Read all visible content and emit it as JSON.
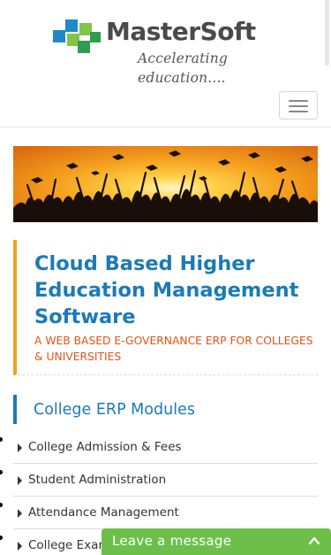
{
  "header": {
    "logo": {
      "brand": "MasterSoft",
      "tagline": "Accelerating education....",
      "icon": "mastersoft-logo-mark"
    },
    "menu_toggle_icon": "hamburger-icon"
  },
  "banner": {
    "image": "graduates-celebration-banner"
  },
  "hero": {
    "title": "Cloud Based Higher Education Management Software",
    "subtitle": "A WEB BASED E-GOVERNANCE ERP FOR COLLEGES & UNIVERSITIES"
  },
  "modules": {
    "heading": "College ERP Modules",
    "items": [
      {
        "label": "College Admission & Fees"
      },
      {
        "label": "Student Administration"
      },
      {
        "label": "Attendance Management"
      },
      {
        "label": "College Exam"
      }
    ]
  },
  "chat": {
    "label": "Leave a message",
    "icon": "chevron-up-icon"
  },
  "colors": {
    "brand_blue": "#1b7ab8",
    "accent_orange": "#f0a21d",
    "subtitle_orange": "#e05414",
    "chat_green": "#6cc04a"
  }
}
